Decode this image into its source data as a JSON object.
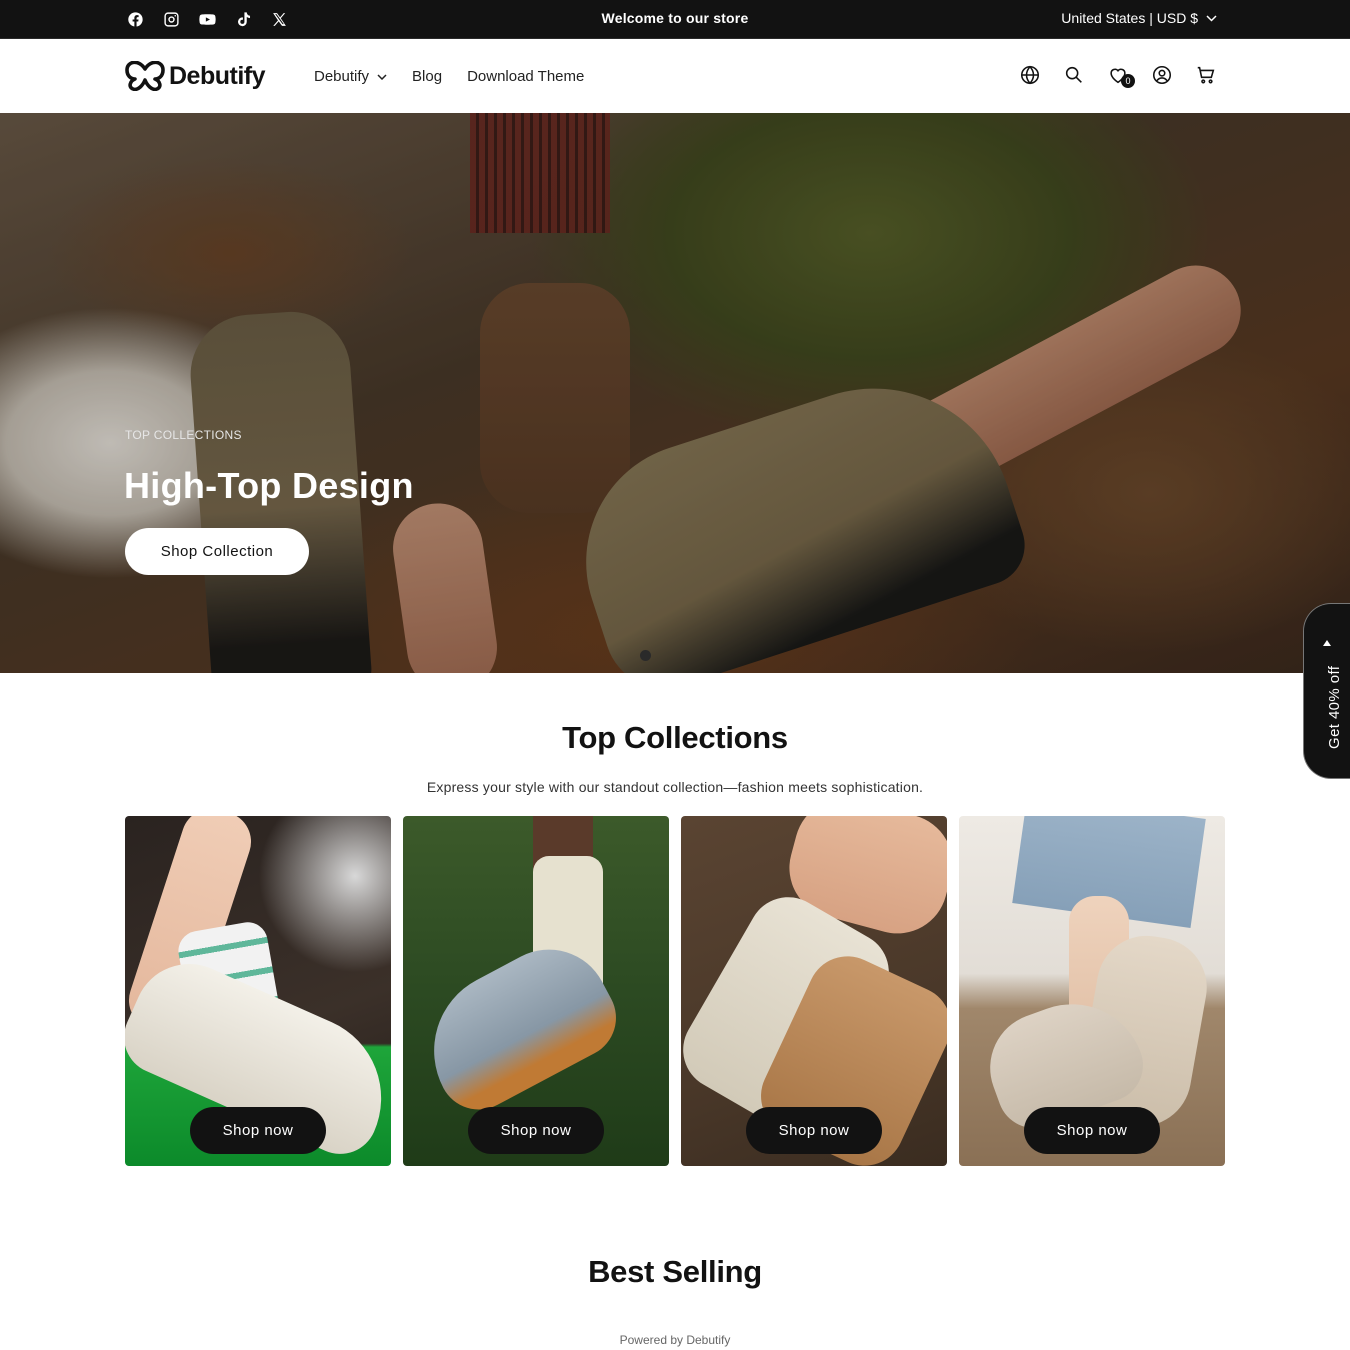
{
  "announcement": {
    "text": "Welcome to our store",
    "social_icons": [
      "facebook-icon",
      "instagram-icon",
      "youtube-icon",
      "tiktok-icon",
      "x-icon"
    ],
    "locale": "United States | USD $"
  },
  "header": {
    "logo_text": "Debutify",
    "nav": [
      {
        "label": "Debutify",
        "has_dropdown": true
      },
      {
        "label": "Blog",
        "has_dropdown": false
      },
      {
        "label": "Download Theme",
        "has_dropdown": false
      }
    ],
    "icons": [
      "globe-icon",
      "search-icon",
      "wishlist-icon",
      "account-icon",
      "cart-icon"
    ],
    "wishlist_count": "0"
  },
  "hero": {
    "subheading": "TOP COLLECTIONS",
    "title": "High-Top Design",
    "button_label": "Shop Collection",
    "slide_count": 1,
    "active_slide": 1
  },
  "promo_tab": {
    "label": "Get 40% off"
  },
  "collections": {
    "title": "Top Collections",
    "description": "Express your style with our standout collection—fashion meets sophistication.",
    "cards": [
      {
        "button_label": "Shop now",
        "image": "white-high-top-sneaker"
      },
      {
        "button_label": "Shop now",
        "image": "retro-running-sneaker-on-grass"
      },
      {
        "button_label": "Shop now",
        "image": "crossover-strap-sandals"
      },
      {
        "button_label": "Shop now",
        "image": "slip-on-canvas-flats"
      }
    ]
  },
  "best_selling": {
    "title": "Best Selling"
  },
  "footer_badge": {
    "text": "Powered by Debutify"
  },
  "colors": {
    "dark": "#121212",
    "white": "#ffffff",
    "text_muted": "#333333"
  }
}
